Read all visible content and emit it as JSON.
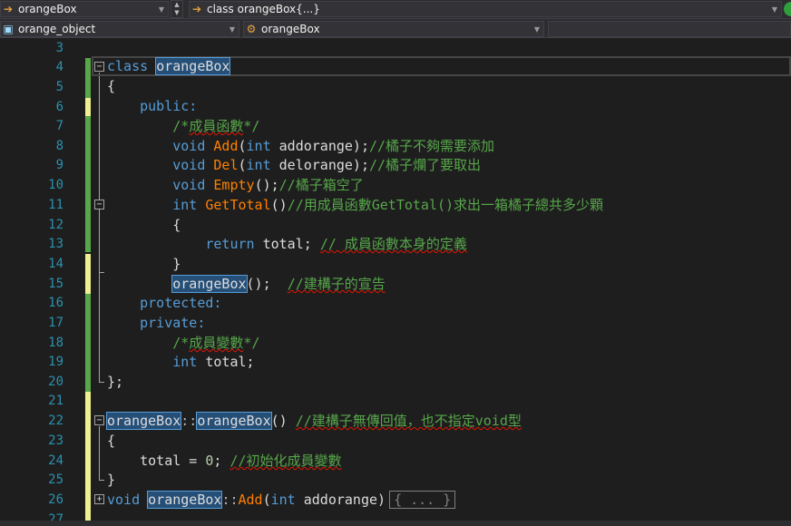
{
  "nav": {
    "project_combo": "orangeBox",
    "member_combo": "class orangeBox{...}",
    "scope_combo": "orange_object",
    "type_combo": "orangeBox",
    "empty_combo": ""
  },
  "editor": {
    "line_numbers": [
      "3",
      "4",
      "5",
      "6",
      "7",
      "8",
      "9",
      "10",
      "11",
      "12",
      "13",
      "14",
      "15",
      "16",
      "17",
      "18",
      "19",
      "20",
      "21",
      "22",
      "23",
      "24",
      "25",
      "26",
      "27"
    ],
    "collapsed_region": "{ ... }"
  },
  "code": {
    "l4_kw": "class",
    "l4_name": "orangeBox",
    "l5": "{",
    "l6": "public:",
    "l7": "/*成員函數*/",
    "l8_void": "void",
    "l8_fn": "Add",
    "l8_paren": "(",
    "l8_int": "int",
    "l8_rest": " addorange);",
    "l8_cm": "//橘子不夠需要添加",
    "l9_void": "void",
    "l9_fn": "Del",
    "l9_paren": "(",
    "l9_int": "int",
    "l9_rest": " delorange);",
    "l9_cm": "//橘子爛了要取出",
    "l10_void": "void",
    "l10_fn": "Empty",
    "l10_rest": "();",
    "l10_cm": "//橘子箱空了",
    "l11_int": "int",
    "l11_fn": "GetTotal",
    "l11_rest": "()",
    "l11_cm": "//用成員函數GetTotal()求出一箱橘子總共多少顆",
    "l12": "{",
    "l13_kw": "return",
    "l13_rest": " total; ",
    "l13_cm": "// 成員函數本身的定義",
    "l14": "}",
    "l15_name": "orangeBox",
    "l15_rest": "();  ",
    "l15_cm": "//建構子的宣告",
    "l16": "protected:",
    "l17": "private:",
    "l18": "/*成員變數*/",
    "l19_int": "int",
    "l19_rest": " total;",
    "l20": "};",
    "l22_name1": "orangeBox",
    "l22_sep": "::",
    "l22_name2": "orangeBox",
    "l22_rest": "() ",
    "l22_cm": "//建構子無傳回值，也不指定void型",
    "l23": "{",
    "l24_rest": "    total = ",
    "l24_num": "0",
    "l24_semi": "; ",
    "l24_cm": "//初始化成員變數",
    "l25": "}",
    "l26_void": "void",
    "l26_name": "orangeBox",
    "l26_sep": "::",
    "l26_fn": "Add",
    "l26_paren": "(",
    "l26_int": "int",
    "l26_rest": " addorange)"
  },
  "colors": {
    "keyword": "#569cd6",
    "function": "#ff8000",
    "comment": "#57a64a",
    "line_number": "#2b91af",
    "background": "#1e1e1e"
  }
}
